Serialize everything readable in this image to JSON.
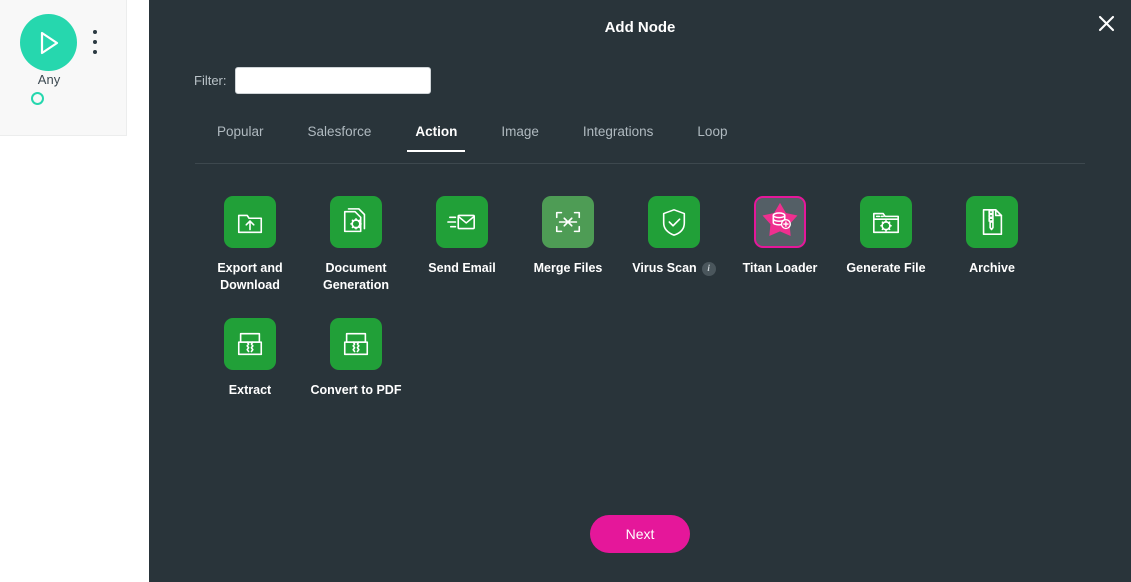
{
  "canvas": {
    "node": {
      "label": "Any",
      "play_icon": "play-icon",
      "menu_icon": "kebab-menu-icon",
      "connector_icon": "connector-circle-icon",
      "add_icon": "add-plus-icon"
    }
  },
  "modal": {
    "title": "Add Node",
    "close_icon": "close-icon",
    "filter": {
      "label": "Filter:",
      "value": "",
      "placeholder": ""
    },
    "tabs": [
      {
        "label": "Popular",
        "active": false
      },
      {
        "label": "Salesforce",
        "active": false
      },
      {
        "label": "Action",
        "active": true
      },
      {
        "label": "Image",
        "active": false
      },
      {
        "label": "Integrations",
        "active": false
      },
      {
        "label": "Loop",
        "active": false
      }
    ],
    "nodes": [
      {
        "label": "Export and Download",
        "icon": "folder-upload-icon",
        "state": "normal",
        "info": false
      },
      {
        "label": "Document Generation",
        "icon": "document-gear-icon",
        "state": "normal",
        "info": false
      },
      {
        "label": "Send Email",
        "icon": "envelope-send-icon",
        "state": "normal",
        "info": false
      },
      {
        "label": "Merge Files",
        "icon": "merge-arrows-icon",
        "state": "dim",
        "info": false
      },
      {
        "label": "Virus Scan",
        "icon": "shield-check-icon",
        "state": "normal",
        "info": true
      },
      {
        "label": "Titan Loader",
        "icon": "star-database-plus-icon",
        "state": "selected",
        "info": false
      },
      {
        "label": "Generate File",
        "icon": "window-gear-icon",
        "state": "normal",
        "info": false
      },
      {
        "label": "Archive",
        "icon": "zip-file-icon",
        "state": "normal",
        "info": false
      },
      {
        "label": "Extract",
        "icon": "extract-box-icon",
        "state": "normal",
        "info": false
      },
      {
        "label": "Convert to PDF",
        "icon": "convert-pdf-box-icon",
        "state": "normal",
        "info": false
      }
    ],
    "info_badge_glyph": "i",
    "next_label": "Next"
  },
  "colors": {
    "modal_bg": "#29343a",
    "tile_green": "#21a038",
    "tile_dim_green": "#4e9c55",
    "accent_pink": "#e5179a",
    "teal": "#26d7ae",
    "selected_tile_bg": "#545f66"
  }
}
